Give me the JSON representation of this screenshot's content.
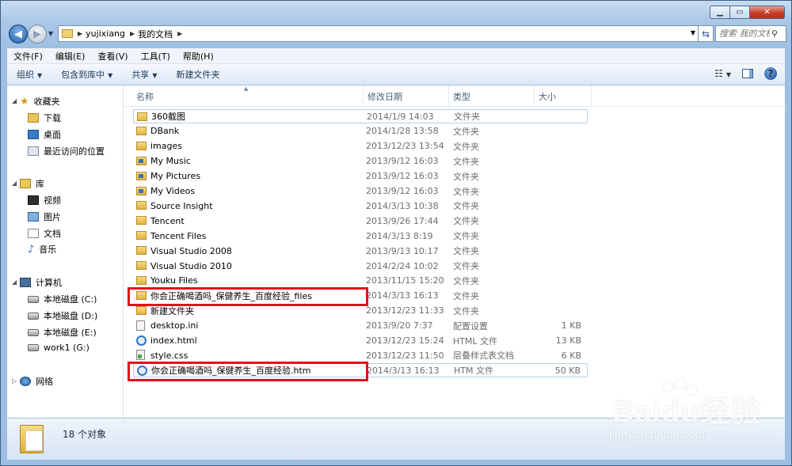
{
  "window": {
    "controls": [
      "minimize",
      "maximize",
      "close"
    ]
  },
  "address": {
    "crumbs": [
      "yujixiang",
      "我的文档"
    ],
    "search_placeholder": "搜索 我的文档"
  },
  "menu": [
    "文件(F)",
    "编辑(E)",
    "查看(V)",
    "工具(T)",
    "帮助(H)"
  ],
  "toolbar": {
    "organize": "组织",
    "include_library": "包含到库中",
    "share": "共享",
    "new_folder": "新建文件夹"
  },
  "nav": {
    "favorites": "收藏夹",
    "downloads": "下载",
    "desktop": "桌面",
    "recent": "最近访问的位置",
    "libraries": "库",
    "videos": "视频",
    "pictures": "图片",
    "documents": "文档",
    "music": "音乐",
    "computer": "计算机",
    "drive_c": "本地磁盘 (C:)",
    "drive_d": "本地磁盘 (D:)",
    "drive_e": "本地磁盘 (E:)",
    "drive_g": "work1 (G:)",
    "network": "网络"
  },
  "columns": {
    "name": "名称",
    "date": "修改日期",
    "type": "类型",
    "size": "大小"
  },
  "files": [
    {
      "name": "360截图",
      "date": "2014/1/9 14:03",
      "type": "文件夹",
      "size": "",
      "icon": "folder"
    },
    {
      "name": "DBank",
      "date": "2014/1/28 13:58",
      "type": "文件夹",
      "size": "",
      "icon": "folder"
    },
    {
      "name": "images",
      "date": "2013/12/23 13:54",
      "type": "文件夹",
      "size": "",
      "icon": "folder"
    },
    {
      "name": "My Music",
      "date": "2013/9/12 16:03",
      "type": "文件夹",
      "size": "",
      "icon": "special-folder"
    },
    {
      "name": "My Pictures",
      "date": "2013/9/12 16:03",
      "type": "文件夹",
      "size": "",
      "icon": "special-folder"
    },
    {
      "name": "My Videos",
      "date": "2013/9/12 16:03",
      "type": "文件夹",
      "size": "",
      "icon": "special-folder"
    },
    {
      "name": "Source Insight",
      "date": "2014/3/13 10:38",
      "type": "文件夹",
      "size": "",
      "icon": "folder"
    },
    {
      "name": "Tencent",
      "date": "2013/9/26 17:44",
      "type": "文件夹",
      "size": "",
      "icon": "folder"
    },
    {
      "name": "Tencent Files",
      "date": "2014/3/13 8:19",
      "type": "文件夹",
      "size": "",
      "icon": "folder"
    },
    {
      "name": "Visual Studio 2008",
      "date": "2013/9/13 10:17",
      "type": "文件夹",
      "size": "",
      "icon": "folder"
    },
    {
      "name": "Visual Studio 2010",
      "date": "2014/2/24 10:02",
      "type": "文件夹",
      "size": "",
      "icon": "folder"
    },
    {
      "name": "Youku Files",
      "date": "2013/11/15 15:20",
      "type": "文件夹",
      "size": "",
      "icon": "folder"
    },
    {
      "name": "你会正确喝酒吗_保健养生_百度经验_files",
      "date": "2014/3/13 16:13",
      "type": "文件夹",
      "size": "",
      "icon": "folder"
    },
    {
      "name": "新建文件夹",
      "date": "2013/12/23 11:33",
      "type": "文件夹",
      "size": "",
      "icon": "folder"
    },
    {
      "name": "desktop.ini",
      "date": "2013/9/20 7:37",
      "type": "配置设置",
      "size": "1 KB",
      "icon": "ini"
    },
    {
      "name": "index.html",
      "date": "2013/12/23 15:24",
      "type": "HTML 文件",
      "size": "13 KB",
      "icon": "ie"
    },
    {
      "name": "style.css",
      "date": "2013/12/23 11:50",
      "type": "层叠样式表文档",
      "size": "6 KB",
      "icon": "css"
    },
    {
      "name": "你会正确喝酒吗_保健养生_百度经验.htm",
      "date": "2014/3/13 16:13",
      "type": "HTM 文件",
      "size": "50 KB",
      "icon": "ie"
    }
  ],
  "status": {
    "count": "18 个对象"
  },
  "watermark": {
    "logo": "Baidu经验",
    "url": "jingyan.baidu.com"
  },
  "colors": {
    "highlight_box": "#e3101b",
    "title_bar": "#a9c6e6"
  }
}
